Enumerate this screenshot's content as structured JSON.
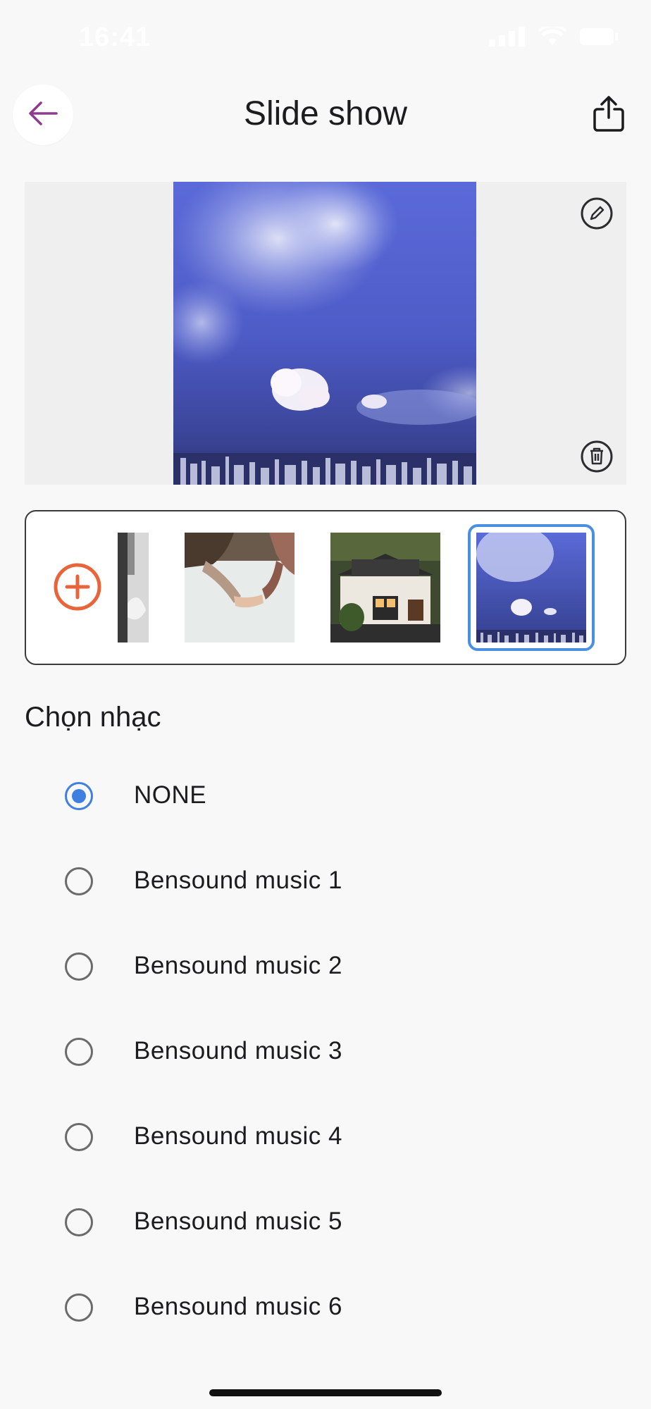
{
  "status_bar": {
    "time": "16:41",
    "icons": [
      "signal-icon",
      "wifi-icon",
      "battery-icon"
    ]
  },
  "header": {
    "title": "Slide show",
    "back_icon": "arrow-left-icon",
    "share_icon": "share-icon"
  },
  "preview": {
    "image": "sky-city-photo",
    "edit_icon": "edit-icon",
    "delete_icon": "trash-icon"
  },
  "thumbnails": {
    "add_icon": "plus-circle-icon",
    "items": [
      "bw-partial-photo",
      "holding-hands-photo",
      "house-photo",
      "sky-city-photo"
    ],
    "selected_index": 3
  },
  "music": {
    "section_title": "Chọn nhạc",
    "selected": "NONE",
    "options": [
      {
        "label": "NONE"
      },
      {
        "label": "Bensound music 1"
      },
      {
        "label": "Bensound music 2"
      },
      {
        "label": "Bensound music 3"
      },
      {
        "label": "Bensound music 4"
      },
      {
        "label": "Bensound music 5"
      },
      {
        "label": "Bensound music 6"
      }
    ]
  },
  "colors": {
    "accent": "#3f7fe0",
    "back_arrow": "#8e3a8e",
    "add_button": "#e8643a",
    "background": "#f8f8f8"
  }
}
